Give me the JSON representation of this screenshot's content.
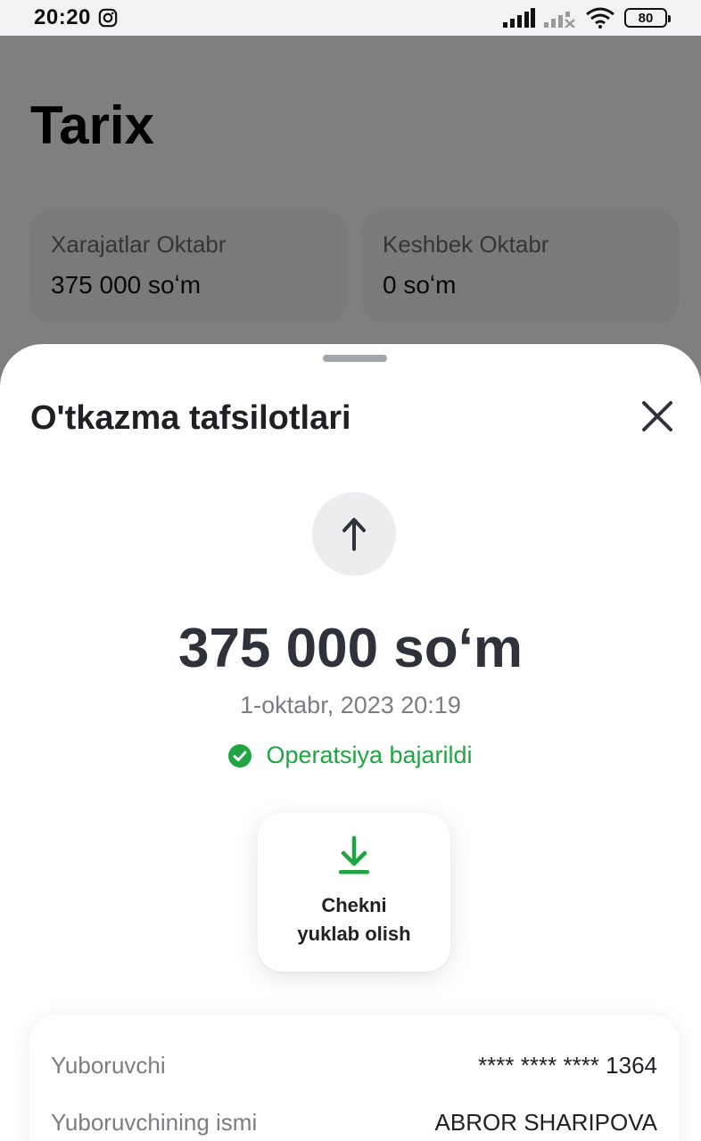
{
  "status_bar": {
    "time": "20:20",
    "battery": "80"
  },
  "background_page": {
    "title": "Tarix",
    "cards": [
      {
        "label": "Xarajatlar Oktabr",
        "value": "375 000 soʻm"
      },
      {
        "label": "Keshbek Oktabr",
        "value": "0 soʻm"
      }
    ]
  },
  "sheet": {
    "title": "O'tkazma tafsilotlari",
    "amount": "375 000 soʻm",
    "datetime": "1-oktabr, 2023 20:19",
    "status_text": "Operatsiya bajarildi",
    "receipt_button": {
      "line1": "Chekni",
      "line2": "yuklab olish"
    },
    "details": [
      {
        "label": "Yuboruvchi",
        "value": "**** **** **** 1364"
      },
      {
        "label": "Yuboruvchining ismi",
        "value": "ABROR SHARIPOVA"
      }
    ]
  },
  "colors": {
    "success": "#1fa542",
    "text_dark": "#2f323a",
    "overlay": "rgba(0,0,0,0.5)"
  }
}
